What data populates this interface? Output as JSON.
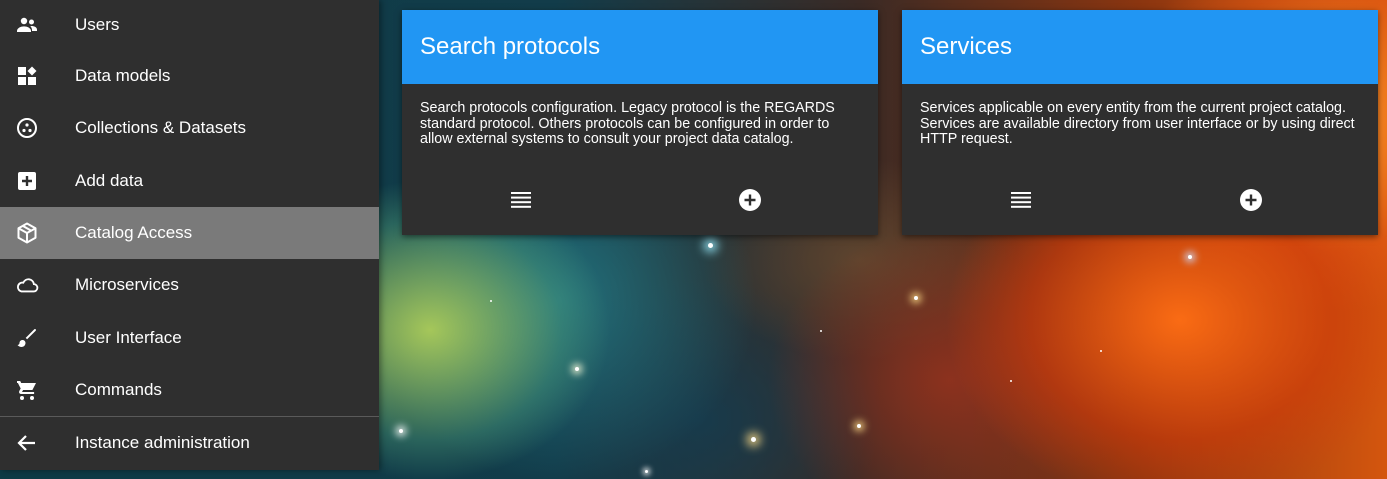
{
  "sidebar": {
    "items": [
      {
        "label": "Users",
        "icon": "users-icon"
      },
      {
        "label": "Data models",
        "icon": "dashboard-icon"
      },
      {
        "label": "Collections & Datasets",
        "icon": "collections-icon"
      },
      {
        "label": "Add data",
        "icon": "add-box-icon"
      },
      {
        "label": "Catalog Access",
        "icon": "cube-icon",
        "active": true
      },
      {
        "label": "Microservices",
        "icon": "cloud-icon"
      },
      {
        "label": "User Interface",
        "icon": "brush-icon"
      },
      {
        "label": "Commands",
        "icon": "cart-icon"
      }
    ],
    "back": {
      "label": "Instance administration",
      "icon": "arrow-back-icon"
    }
  },
  "cards": [
    {
      "title": "Search protocols",
      "description": "Search protocols configuration. Legacy protocol is the REGARDS standard protocol. Others protocols can be configured in order to allow external systems to consult your project data catalog.",
      "actions": [
        "list-icon",
        "add-circle-icon"
      ]
    },
    {
      "title": "Services",
      "description": "Services applicable on every entity from the current project catalog. Services are available directory from user interface or by using direct HTTP request.",
      "actions": [
        "list-icon",
        "add-circle-icon"
      ]
    }
  ],
  "colors": {
    "accent": "#2196f3",
    "panel": "#2f2f2f",
    "active": "#7a7a7a"
  }
}
